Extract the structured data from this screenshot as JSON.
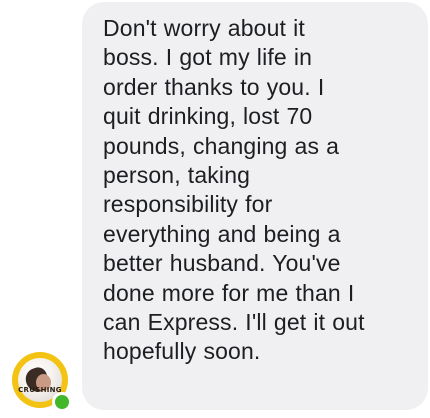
{
  "message": {
    "lines": [
      "Don't worry about it",
      "boss. I got my life in",
      "order thanks to you. I",
      "quit drinking, lost 70",
      "pounds, changing as a",
      "person, taking",
      "responsibility for",
      "everything and being a",
      "better husband. You've",
      "done more for me than I",
      "can Express. I'll get it out",
      "hopefully soon."
    ]
  },
  "sender": {
    "avatar_icon": "profile-photo-icon",
    "avatar_brand": "CRUSHING",
    "online": true,
    "presence_color": "#42b72a",
    "ring_color": "#f2c312"
  },
  "colors": {
    "bubble_background": "#f0f0f2",
    "text": "#1c1e21"
  }
}
